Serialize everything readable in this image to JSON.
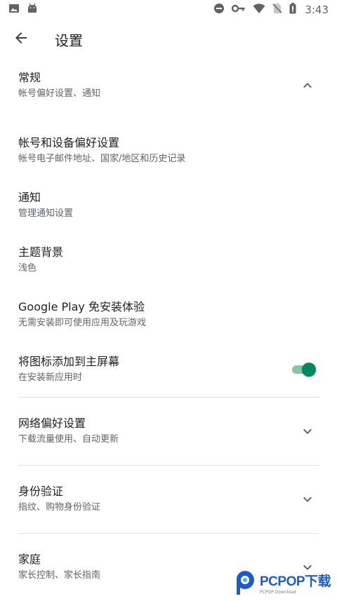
{
  "status_bar": {
    "time": "3:43",
    "icons_left": [
      "image-icon",
      "android-icon"
    ],
    "icons_right": [
      "do-not-disturb-icon",
      "vpn-key-icon",
      "wifi-icon",
      "no-sim-icon",
      "battery-icon"
    ]
  },
  "app_bar": {
    "title": "设置",
    "back_icon": "arrow-back-icon"
  },
  "settings": {
    "general": {
      "title": "常规",
      "subtitle": "帐号偏好设置、通知",
      "icon": "chevron-up-icon"
    },
    "account": {
      "title": "帐号和设备偏好设置",
      "subtitle": "帐号电子邮件地址、国家/地区和历史记录"
    },
    "notifications": {
      "title": "通知",
      "subtitle": "管理通知设置"
    },
    "theme": {
      "title": "主题背景",
      "subtitle": "浅色"
    },
    "instant": {
      "title": "Google Play 免安装体验",
      "subtitle": "无需安装即可使用应用及玩游戏"
    },
    "add_icon": {
      "title": "将图标添加到主屏幕",
      "subtitle": "在安装新应用时",
      "toggle_on": true
    },
    "network": {
      "title": "网络偏好设置",
      "subtitle": "下载流量使用、自动更新",
      "icon": "chevron-down-icon"
    },
    "auth": {
      "title": "身份验证",
      "subtitle": "指纹、购物身份验证",
      "icon": "chevron-down-icon"
    },
    "family": {
      "title": "家庭",
      "subtitle": "家长控制、家长指南",
      "icon": "chevron-down-icon"
    }
  },
  "watermark": {
    "brand": "PCPOP下载",
    "sub": "PCPOP Download"
  },
  "colors": {
    "accent": "#01875f",
    "track": "#88c4a5",
    "text": "#202124",
    "secondary": "#5f6368"
  }
}
